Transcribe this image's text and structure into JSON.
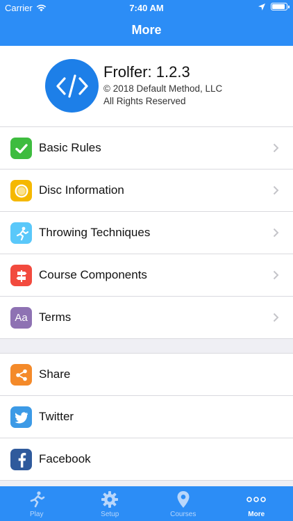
{
  "status_bar": {
    "carrier": "Carrier",
    "time": "7:40 AM",
    "battery_level": 0.9
  },
  "nav": {
    "title": "More"
  },
  "app_info": {
    "name": "Frolfer: 1.2.3",
    "copyright": "© 2018 Default Method, LLC",
    "rights": "All Rights Reserved",
    "logo_color": "#1d7fe8"
  },
  "menu": [
    {
      "label": "Basic Rules",
      "icon": "checkmark-icon",
      "color": "#3ebc3f"
    },
    {
      "label": "Disc Information",
      "icon": "disc-icon",
      "color": "#f5b800"
    },
    {
      "label": "Throwing Techniques",
      "icon": "thrower-icon",
      "color": "#5ac8fa"
    },
    {
      "label": "Course Components",
      "icon": "signpost-icon",
      "color": "#f24a3e"
    },
    {
      "label": "Terms",
      "icon": "glossary-icon",
      "glyph": "Aa",
      "color": "#8e72b3"
    }
  ],
  "social": [
    {
      "label": "Share",
      "icon": "share-icon",
      "color": "#f48a2a"
    },
    {
      "label": "Twitter",
      "icon": "twitter-icon",
      "color": "#3c9ae6"
    },
    {
      "label": "Facebook",
      "icon": "facebook-icon",
      "color": "#2f5a9c"
    }
  ],
  "tabs": [
    {
      "label": "Play",
      "icon": "runner-icon"
    },
    {
      "label": "Setup",
      "icon": "gear-icon"
    },
    {
      "label": "Courses",
      "icon": "location-pin-icon"
    },
    {
      "label": "More",
      "icon": "more-dots-icon",
      "active": true
    }
  ],
  "colors": {
    "primary": "#2c8df6",
    "tab_inactive": "#b9d7fb"
  }
}
